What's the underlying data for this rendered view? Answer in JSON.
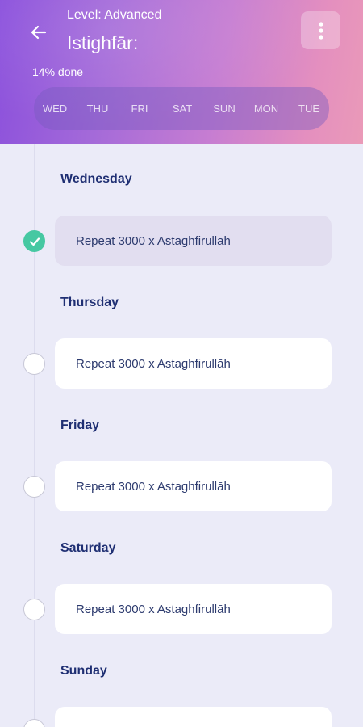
{
  "header": {
    "level": "Level: Advanced",
    "title": "Istighfār:",
    "progress": "14% done",
    "gradient_colors": [
      "#8a4fdc",
      "#c67dd2",
      "#ea9ab8"
    ]
  },
  "day_strip": [
    "WED",
    "THU",
    "FRI",
    "SAT",
    "SUN",
    "MON",
    "TUE"
  ],
  "days": [
    {
      "name": "Wednesday",
      "task": "Repeat 3000 x Astaghfirullāh",
      "completed": true
    },
    {
      "name": "Thursday",
      "task": "Repeat 3000 x Astaghfirullāh",
      "completed": false
    },
    {
      "name": "Friday",
      "task": "Repeat 3000 x Astaghfirullāh",
      "completed": false
    },
    {
      "name": "Saturday",
      "task": "Repeat 3000 x Astaghfirullāh",
      "completed": false
    },
    {
      "name": "Sunday",
      "task": "",
      "completed": false
    }
  ],
  "icons": {
    "back": "arrow-left-icon",
    "menu": "more-vertical-icon",
    "check": "check-icon"
  },
  "colors": {
    "accent_check": "#46c8a2",
    "heading": "#1f2f73",
    "background": "#ebebf8"
  }
}
